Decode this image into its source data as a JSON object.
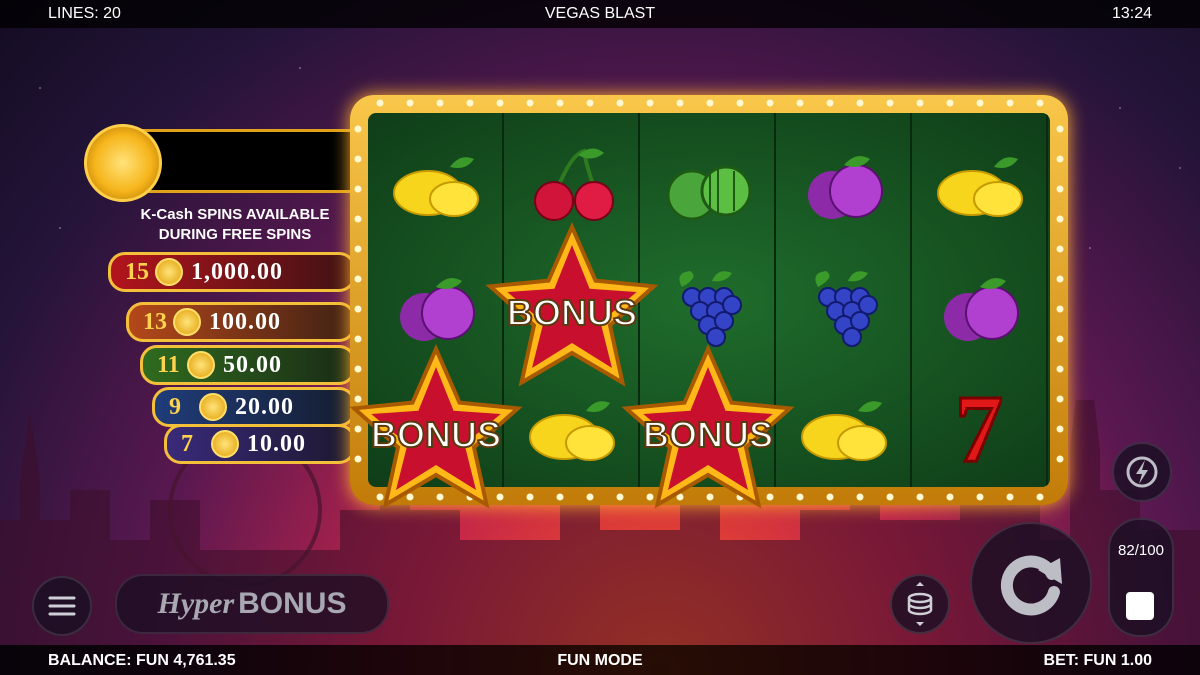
{
  "topbar": {
    "lines": "LINES: 20",
    "title": "VEGAS BLAST",
    "time": "13:24"
  },
  "bottombar": {
    "balance": "BALANCE: FUN 4,761.35",
    "mode": "FUN MODE",
    "bet": "BET: FUN 1.00"
  },
  "side_panel": {
    "kcash_line1": "K-Cash SPINS AVAILABLE",
    "kcash_line2": "DURING FREE SPINS",
    "prizes": [
      {
        "count": "15",
        "value": "1,000.00",
        "color": "#b3141c"
      },
      {
        "count": "13",
        "value": "100.00",
        "color": "#b4481a"
      },
      {
        "count": "11",
        "value": "50.00",
        "color": "#2f6b1f"
      },
      {
        "count": "9",
        "value": "20.00",
        "color": "#1f3c7a"
      },
      {
        "count": "7",
        "value": "10.00",
        "color": "#3a2a7a"
      }
    ]
  },
  "reels": [
    [
      "lemon",
      "plum",
      "bonus-star"
    ],
    [
      "cherry",
      "bonus-star",
      "lemon"
    ],
    [
      "watermelon",
      "grapes",
      "bonus-star"
    ],
    [
      "plum",
      "grapes",
      "lemon"
    ],
    [
      "lemon",
      "plum",
      "seven"
    ]
  ],
  "bonus_label": "BONUS",
  "controls": {
    "hyper_prefix": "Hyper",
    "hyper_suffix": "BONUS",
    "autoplay_count": "82/100",
    "menu_icon": "menu-icon",
    "stack_icon": "coin-stack-icon",
    "spin_icon": "spin-icon",
    "turbo_icon": "lightning-icon",
    "stop_icon": "stop-icon"
  }
}
